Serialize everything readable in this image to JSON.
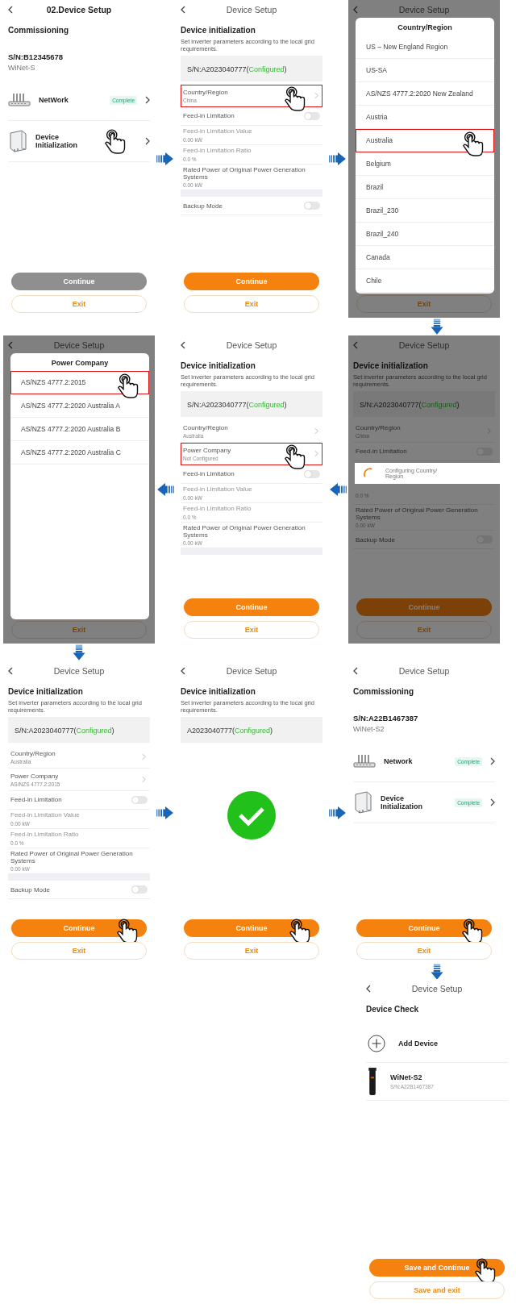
{
  "flow": [
    {
      "kind": "row",
      "items": [
        {
          "kind": "commissioning",
          "title": "02.Device Setup",
          "title_bold": true,
          "dimmed": false,
          "heading": "Commissioning",
          "serial": "S/N:B12345678",
          "model": "WiNet-S",
          "items": [
            {
              "kind": "router",
              "label": "NetWork",
              "badge": "Complete",
              "tap": false
            },
            {
              "kind": "inverter",
              "label": "Device Initialization",
              "tap": true
            }
          ],
          "buttons": [
            {
              "label": "Continue",
              "kind": "disabled",
              "tap": false
            },
            {
              "label": "Exit",
              "kind": "outline",
              "tap": false
            }
          ]
        },
        {
          "kind": "arrow-right"
        },
        {
          "kind": "init",
          "title": "Device Setup",
          "title_bold": false,
          "dimmed": false,
          "heading": "Device initialization",
          "description": "Set inverter parameters according to the local grid requirements.",
          "serial_parts": [
            {
              "text": "S/N:A2023040777(",
              "kind": "plain"
            },
            {
              "text": "Configured",
              "kind": "ok"
            },
            {
              "text": ")",
              "kind": "plain"
            }
          ],
          "rows": [
            {
              "kind": "nav",
              "label": "Country/Region",
              "value": "China",
              "highlighted": true,
              "tap": true
            },
            {
              "kind": "toggle",
              "label": "Feed-in Limitation",
              "on": false
            },
            {
              "kind": "value",
              "label": "Feed-in Limitation Value",
              "value": "0.00 kW",
              "disabled": true
            },
            {
              "kind": "value",
              "label": "Feed-in Limitation Ratio",
              "value": "0.0 %",
              "disabled": true
            },
            {
              "kind": "value",
              "label": "Rated Power of Original Power Generation Systems",
              "value": "0.00 kW",
              "disabled": false
            },
            {
              "kind": "gap"
            },
            {
              "kind": "toggle",
              "label": "Backup Mode",
              "on": false
            }
          ],
          "buttons": [
            {
              "label": "Continue",
              "kind": "primary",
              "tap": false
            },
            {
              "label": "Exit",
              "kind": "outline",
              "tap": false
            }
          ]
        },
        {
          "kind": "arrow-right"
        },
        {
          "kind": "picker",
          "title": "Device Setup",
          "title_bold": false,
          "dimmed": true,
          "modal": {
            "title": "Country/Region",
            "options": [
              {
                "label": "US – New England Region",
                "highlighted": false,
                "tap": false
              },
              {
                "label": "US-SA",
                "highlighted": false,
                "tap": false
              },
              {
                "label": "AS/NZS 4777.2:2020 New Zealand",
                "highlighted": false,
                "tap": false
              },
              {
                "label": "Austria",
                "highlighted": false,
                "tap": false
              },
              {
                "label": "Australia",
                "highlighted": true,
                "tap": true
              },
              {
                "label": "Belgium",
                "highlighted": false,
                "tap": false
              },
              {
                "label": "Brazil",
                "highlighted": false,
                "tap": false
              },
              {
                "label": "Brazil_230",
                "highlighted": false,
                "tap": false
              },
              {
                "label": "Brazil_240",
                "highlighted": false,
                "tap": false
              },
              {
                "label": "Canada",
                "highlighted": false,
                "tap": false
              },
              {
                "label": "Chile",
                "highlighted": false,
                "tap": false
              }
            ]
          },
          "buttons": [
            {
              "label": "Exit",
              "kind": "outline",
              "tap": false
            }
          ]
        }
      ]
    },
    {
      "kind": "down-arrow-end"
    },
    {
      "kind": "row",
      "items": [
        {
          "kind": "picker",
          "title": "Device Setup",
          "title_bold": false,
          "dimmed": true,
          "modal": {
            "title": "Power Company",
            "options": [
              {
                "label": "AS/NZS 4777.2:2015",
                "highlighted": true,
                "tap": true
              },
              {
                "label": "AS/NZS 4777.2:2020 Australia A",
                "highlighted": false,
                "tap": false
              },
              {
                "label": "AS/NZS 4777.2:2020 Australia B",
                "highlighted": false,
                "tap": false
              },
              {
                "label": "AS/NZS 4777.2:2020 Australia C",
                "highlighted": false,
                "tap": false
              }
            ]
          },
          "buttons": [
            {
              "label": "Exit",
              "kind": "outline",
              "tap": false
            }
          ]
        },
        {
          "kind": "arrow-left"
        },
        {
          "kind": "init",
          "title": "Device Setup",
          "title_bold": false,
          "dimmed": false,
          "heading": "Device initialization",
          "description": "Set inverter parameters according to the local grid requirements.",
          "serial_parts": [
            {
              "text": "S/N:A2023040777(",
              "kind": "plain"
            },
            {
              "text": "Configured",
              "kind": "ok"
            },
            {
              "text": ")",
              "kind": "plain"
            }
          ],
          "rows": [
            {
              "kind": "nav",
              "label": "Country/Region",
              "value": "Australia",
              "highlighted": false,
              "tap": false
            },
            {
              "kind": "nav",
              "label": "Power Company",
              "value": "Not Configured",
              "highlighted": true,
              "tap": true
            },
            {
              "kind": "toggle",
              "label": "Feed-in Limitation",
              "on": false
            },
            {
              "kind": "value",
              "label": "Feed-in Limitation Value",
              "value": "0.00 kW",
              "disabled": true
            },
            {
              "kind": "value",
              "label": "Feed-in Limitation Ratio",
              "value": "0.0 %",
              "disabled": true
            },
            {
              "kind": "value",
              "label": "Rated Power of Original Power Generation Systems",
              "value": "0.00 kW",
              "disabled": false
            },
            {
              "kind": "gap"
            }
          ],
          "buttons": [
            {
              "label": "Continue",
              "kind": "primary",
              "tap": false
            },
            {
              "label": "Exit",
              "kind": "outline",
              "tap": false
            }
          ]
        },
        {
          "kind": "arrow-left"
        },
        {
          "kind": "init",
          "title": "Device Setup",
          "title_bold": false,
          "dimmed": true,
          "heading": "Device initialization",
          "description": "Set inverter parameters according to the local grid requirements.",
          "serial_parts": [
            {
              "text": "S/N:A2023040777(",
              "kind": "plain"
            },
            {
              "text": "Configured",
              "kind": "ok"
            },
            {
              "text": ")",
              "kind": "plain"
            }
          ],
          "rows": [
            {
              "kind": "nav",
              "label": "Country/Region",
              "value": "China",
              "highlighted": false,
              "tap": false
            },
            {
              "kind": "toggle",
              "label": "Feed-in Limitation",
              "on": false
            },
            {
              "kind": "loading",
              "label": "Configuring Country/ Region"
            },
            {
              "kind": "value",
              "value": "0.0 %"
            },
            {
              "kind": "value",
              "label": "Rated Power of Original Power Generation Systems",
              "value": "0.00 kW",
              "disabled": false
            },
            {
              "kind": "toggle",
              "label": "Backup Mode",
              "on": false
            }
          ],
          "buttons": [
            {
              "label": "Continue",
              "kind": "primary",
              "tap": false
            },
            {
              "label": "Exit",
              "kind": "outline",
              "tap": false
            }
          ]
        }
      ]
    },
    {
      "kind": "down-arrow-start"
    },
    {
      "kind": "row",
      "items": [
        {
          "kind": "init",
          "title": "Device Setup",
          "title_bold": false,
          "dimmed": false,
          "heading": "Device initialization",
          "description": "Set inverter parameters according to the local grid requirements.",
          "serial_parts": [
            {
              "text": "S/N:A2023040777(",
              "kind": "plain"
            },
            {
              "text": "Configured",
              "kind": "ok"
            },
            {
              "text": ")",
              "kind": "plain"
            }
          ],
          "rows": [
            {
              "kind": "nav",
              "label": "Country/Region",
              "value": "Australia",
              "highlighted": false,
              "tap": false
            },
            {
              "kind": "nav",
              "label": "Power Company",
              "value": "AS/NZS 4777.2:2015",
              "highlighted": false,
              "tap": false
            },
            {
              "kind": "toggle",
              "label": "Feed-in Limitation",
              "on": false
            },
            {
              "kind": "value",
              "label": "Feed-in Limitation Value",
              "value": "0.00 kW",
              "disabled": true
            },
            {
              "kind": "value",
              "label": "Feed-in Limitation Ratio",
              "value": "0.0 %",
              "disabled": true
            },
            {
              "kind": "value",
              "label": "Rated Power of Original Power Generation Systems",
              "value": "0.00 kW",
              "disabled": false
            },
            {
              "kind": "gap"
            },
            {
              "kind": "toggle",
              "label": "Backup Mode",
              "on": false
            }
          ],
          "buttons": [
            {
              "label": "Continue",
              "kind": "primary",
              "tap": true
            },
            {
              "label": "Exit",
              "kind": "outline",
              "tap": false
            }
          ]
        },
        {
          "kind": "arrow-right"
        },
        {
          "kind": "success",
          "title": "Device Setup",
          "title_bold": false,
          "dimmed": false,
          "heading": "Device initialization",
          "description": "Set inverter parameters according to the local grid requirements.",
          "serial_parts": [
            {
              "text": "A2023040777(",
              "kind": "plain"
            },
            {
              "text": "Configured",
              "kind": "ok"
            },
            {
              "text": ")",
              "kind": "plain"
            }
          ],
          "buttons": [
            {
              "label": "Continue",
              "kind": "primary",
              "tap": true
            },
            {
              "label": "Exit",
              "kind": "outline",
              "tap": false
            }
          ]
        },
        {
          "kind": "arrow-right"
        },
        {
          "kind": "commissioning",
          "title": "Device Setup",
          "title_bold": false,
          "dimmed": false,
          "heading": "Commissioning",
          "serial": "S/N:A22B1467387",
          "model": "WiNet-S2",
          "items": [
            {
              "kind": "router",
              "label": "Network",
              "badge": "Complete",
              "tap": false
            },
            {
              "kind": "inverter",
              "label": "Device Initialization",
              "badge": "Complete",
              "tap": false
            }
          ],
          "buttons": [
            {
              "label": "Continue",
              "kind": "primary",
              "tap": true
            },
            {
              "label": "Exit",
              "kind": "outline",
              "tap": false
            }
          ]
        }
      ]
    },
    {
      "kind": "down-arrow-end"
    },
    {
      "kind": "row-end",
      "items": [
        {
          "kind": "check",
          "title": "Device Setup",
          "title_bold": false,
          "dimmed": false,
          "heading": "Device Check",
          "items": [
            {
              "kind": "add",
              "label": "Add Device"
            },
            {
              "kind": "device",
              "label": "WiNet-S2",
              "serial": "S/N:A22B1467387"
            }
          ],
          "buttons": [
            {
              "label": "Save and Continue",
              "kind": "primary",
              "tap": true
            },
            {
              "label": "Save and exit",
              "kind": "outline",
              "tap": false
            }
          ]
        }
      ]
    }
  ]
}
